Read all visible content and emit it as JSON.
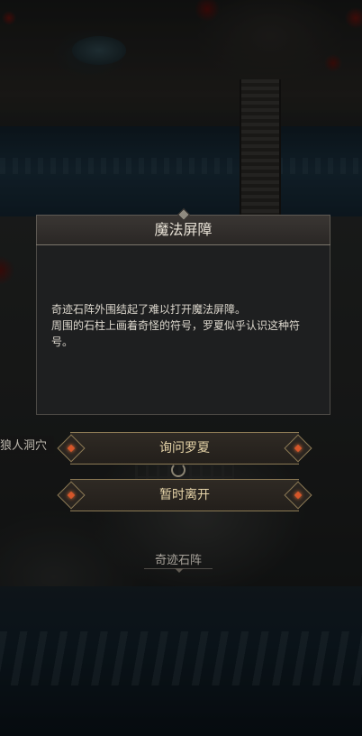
{
  "dialog": {
    "title": "魔法屏障",
    "body_line1": "奇迹石阵外围结起了难以打开魔法屏障。",
    "body_line2": "周围的石柱上画着奇怪的符号，罗夏似乎认识这种符号。"
  },
  "options": [
    {
      "label": "询问罗夏"
    },
    {
      "label": "暂时离开"
    }
  ],
  "map_labels": {
    "cave": "狼人洞穴",
    "stones": "奇迹石阵"
  },
  "colors": {
    "option_text": "#e6d4a8",
    "gem_accent": "#d6562a",
    "dialog_bg": "#1e1f20"
  },
  "icons": {
    "option_gem": "diamond-gem-icon",
    "path_ring": "ring-icon"
  }
}
